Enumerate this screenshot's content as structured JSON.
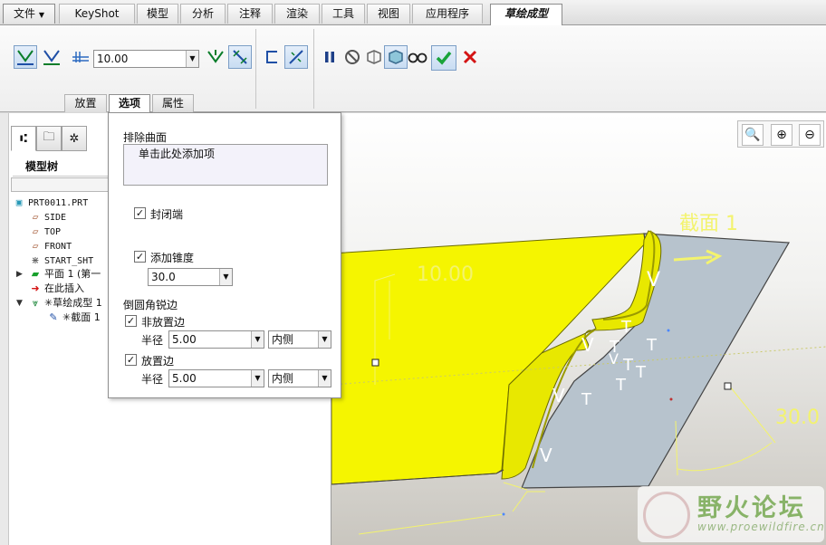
{
  "menubar": {
    "file": "文件",
    "tabs": [
      "KeyShot",
      "模型",
      "分析",
      "注释",
      "渲染",
      "工具",
      "视图",
      "应用程序"
    ],
    "active_tab": "草绘成型"
  },
  "ribbon": {
    "thickness_value": "10.00",
    "subtabs": [
      "放置",
      "选项",
      "属性"
    ],
    "active_subtab": "选项"
  },
  "panel": {
    "tree_title": "模型树",
    "items": [
      {
        "icon": "part-icon",
        "label": "PRT0011.PRT"
      },
      {
        "icon": "datum-plane-icon",
        "label": "SIDE"
      },
      {
        "icon": "datum-plane-icon",
        "label": "TOP"
      },
      {
        "icon": "datum-plane-icon",
        "label": "FRONT"
      },
      {
        "icon": "csys-icon",
        "label": "START_SHT"
      },
      {
        "icon": "planar-wall-icon",
        "label": "平面 1 (第一"
      },
      {
        "icon": "insert-here-icon",
        "label": "在此插入"
      },
      {
        "icon": "sketched-form-icon",
        "label": "✳草绘成型 1"
      },
      {
        "icon": "sketch-icon",
        "label": "✳截面 1"
      }
    ]
  },
  "options": {
    "exclude_surfaces_label": "排除曲面",
    "collector_text": "单击此处添加项",
    "cap_ends_label": "封闭端",
    "cap_ends_checked": true,
    "add_taper_label": "添加锥度",
    "add_taper_checked": true,
    "taper_value": "30.0",
    "round_sharp_edges_label": "倒圆角锐边",
    "non_placement_edges_label": "非放置边",
    "non_placement_checked": true,
    "radius_label": "半径",
    "non_placement_radius": "5.00",
    "non_placement_side": "内侧",
    "placement_edges_label": "放置边",
    "placement_checked": true,
    "placement_radius": "5.00",
    "placement_side": "内侧"
  },
  "graphics": {
    "section_label": "截面 1",
    "depth_dim": "10.00",
    "angle_dim": "30.0",
    "surface_marks": [
      "V",
      "T",
      "V",
      "T",
      "T",
      "V",
      "T",
      "T",
      "T",
      "V",
      "T",
      "V"
    ]
  },
  "watermark": {
    "title": "野火论坛",
    "url": "www.proewildfire.cn"
  },
  "colors": {
    "part_yellow": "#f5f500",
    "sheet_gray": "#b7c3cd",
    "dim_yellow": "#f3f36e",
    "ok_green": "#19a33a",
    "cancel_red": "#d41414"
  }
}
